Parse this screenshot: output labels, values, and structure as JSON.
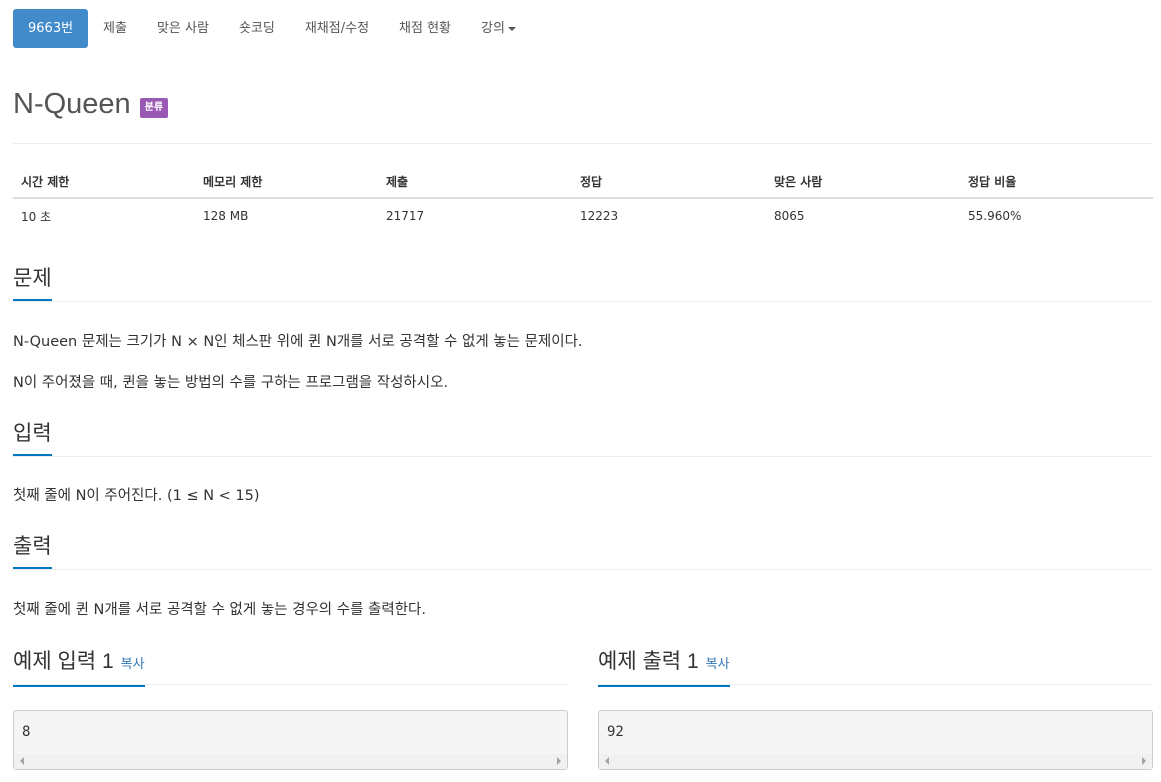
{
  "nav": {
    "tabs": [
      {
        "label": "9663번"
      },
      {
        "label": "제출"
      },
      {
        "label": "맞은 사람"
      },
      {
        "label": "숏코딩"
      },
      {
        "label": "재채점/수정"
      },
      {
        "label": "채점 현황"
      },
      {
        "label": "강의"
      }
    ]
  },
  "problem": {
    "title": "N-Queen",
    "badge": "분류"
  },
  "info": {
    "headers": [
      "시간 제한",
      "메모리 제한",
      "제출",
      "정답",
      "맞은 사람",
      "정답 비율"
    ],
    "values": [
      "10 초",
      "128 MB",
      "21717",
      "12223",
      "8065",
      "55.960%"
    ]
  },
  "sections": {
    "description": {
      "heading": "문제",
      "paragraphs": [
        "N-Queen 문제는 크기가 N × N인 체스판 위에 퀸 N개를 서로 공격할 수 없게 놓는 문제이다.",
        "N이 주어졌을 때, 퀸을 놓는 방법의 수를 구하는 프로그램을 작성하시오."
      ]
    },
    "input": {
      "heading": "입력",
      "text": "첫째 줄에 N이 주어진다. (1 ≤ N < 15)"
    },
    "output": {
      "heading": "출력",
      "text": "첫째 줄에 퀸 N개를 서로 공격할 수 없게 놓는 경우의 수를 출력한다."
    }
  },
  "examples": {
    "input": {
      "heading": "예제 입력 1",
      "copy": "복사",
      "value": "8"
    },
    "output": {
      "heading": "예제 출력 1",
      "copy": "복사",
      "value": "92"
    }
  },
  "colors": {
    "active_tab": "#428bca",
    "badge": "#9b59b6",
    "section_underline": "#0076c0",
    "link": "#337ab7"
  }
}
